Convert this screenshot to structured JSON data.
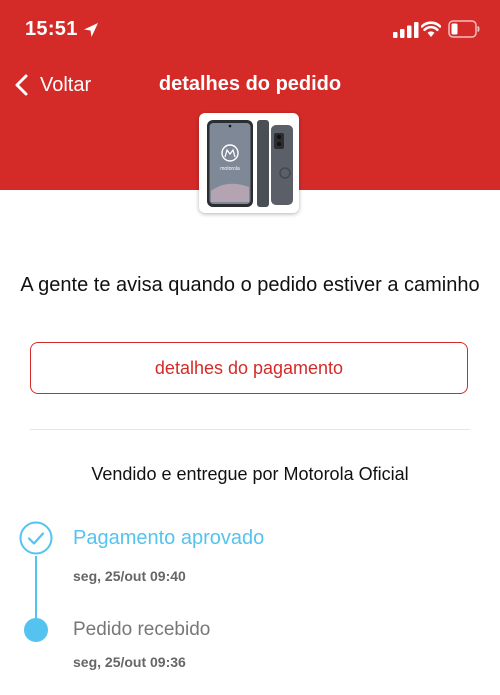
{
  "status_bar": {
    "time": "15:51"
  },
  "nav": {
    "back_label": "Voltar",
    "title": "detalhes do pedido"
  },
  "colors": {
    "header": "#d42b29",
    "accent_blue": "#54c3f0",
    "button_border": "#d42b29"
  },
  "product": {
    "image_text": "motorola"
  },
  "notice": "A gente te avisa quando o pedido estiver a caminho",
  "payment_button_label": "detalhes do pagamento",
  "seller_text": "Vendido e entregue por Motorola Oficial",
  "timeline": [
    {
      "title": "Pagamento aprovado",
      "date": "seg, 25/out 09:40",
      "state": "done"
    },
    {
      "title": "Pedido recebido",
      "date": "seg, 25/out 09:36",
      "state": "current"
    }
  ]
}
